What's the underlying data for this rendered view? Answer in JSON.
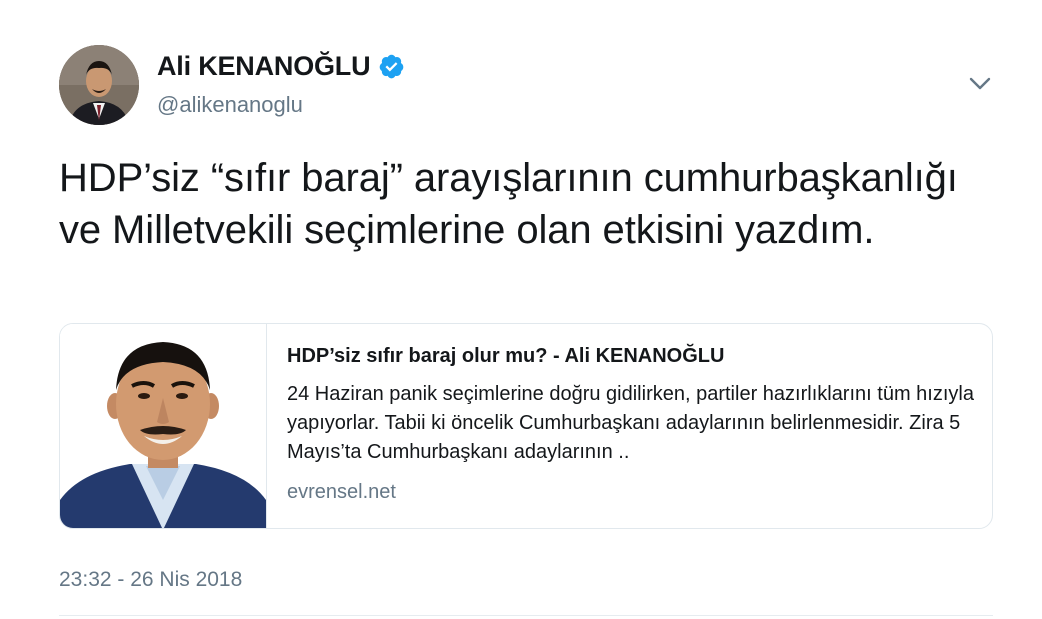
{
  "author": {
    "display_name": "Ali KENANOĞLU",
    "handle": "@alikenanoglu",
    "verified": true
  },
  "tweet": {
    "text": "HDP’siz “sıfır baraj” arayışlarının cumhurbaşkanlığı ve Milletvekili seçimlerine olan etkisini yazdım.",
    "timestamp": "23:32 - 26 Nis 2018"
  },
  "card": {
    "title": "HDP’siz sıfır baraj olur mu? - Ali KENANOĞLU",
    "description": "24 Haziran panik seçimlerine doğru gidilirken, partiler hazırlıklarını tüm hızıyla yapıyorlar. Tabii ki öncelik Cumhurbaşkanı adaylarının belirlenmesidir. Zira 5 Mayıs’ta Cumhurbaşkanı adaylarının ..",
    "domain": "evrensel.net"
  },
  "icons": {
    "verified": "verified-badge-icon",
    "menu": "chevron-down-icon"
  },
  "colors": {
    "verified_blue": "#1da1f2",
    "secondary_text": "#657786",
    "primary_text": "#14171a",
    "border": "#e1e8ed"
  }
}
